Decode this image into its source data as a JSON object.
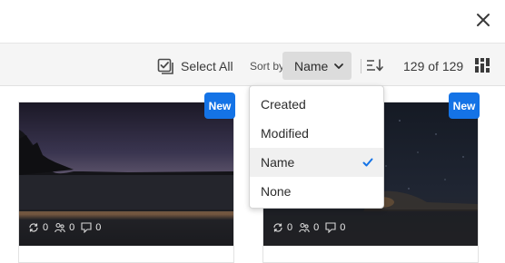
{
  "toolbar": {
    "select_all_label": "Select All",
    "sort_by_label": "Sort by",
    "sort_value": "Name",
    "count": "129 of 129"
  },
  "sort_menu": {
    "items": [
      {
        "label": "Created",
        "selected": false
      },
      {
        "label": "Modified",
        "selected": false
      },
      {
        "label": "Name",
        "selected": true
      },
      {
        "label": "None",
        "selected": false
      }
    ]
  },
  "cards": [
    {
      "badge": "New",
      "sync_count": "0",
      "people_count": "0",
      "comment_count": "0"
    },
    {
      "badge": "New",
      "sync_count": "0",
      "people_count": "0",
      "comment_count": "0"
    }
  ],
  "icons": {
    "close": "close-icon",
    "select_all": "checkbox-icon",
    "sort_dropdown": "chevron-down-icon",
    "sort_order": "sort-order-icon",
    "grid_view": "grid-view-icon",
    "sync": "sync-icon",
    "people": "people-icon",
    "comment": "comment-icon",
    "selected": "checkmark-icon"
  },
  "colors": {
    "accent": "#1473e6",
    "toolbar_bg": "#f5f5f5",
    "dropdown_bg": "#dcdcdc"
  }
}
